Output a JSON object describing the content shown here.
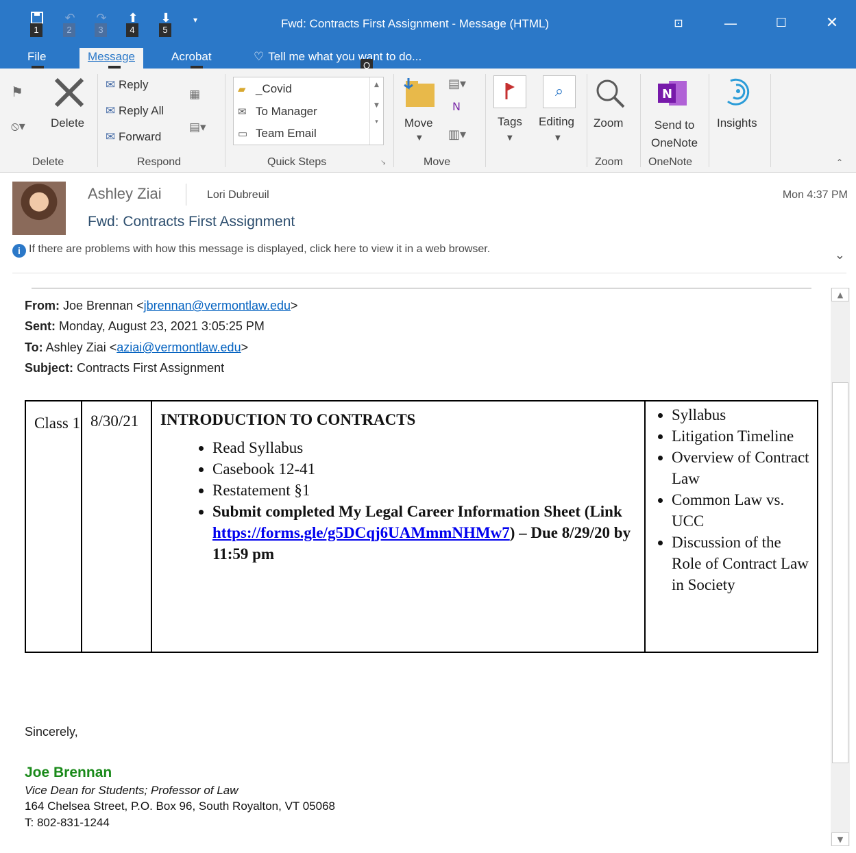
{
  "window": {
    "title": "Fwd: Contracts First Assignment - Message (HTML)",
    "qat": [
      {
        "icon": "save-icon",
        "key": "1"
      },
      {
        "icon": "undo-icon",
        "key": "2"
      },
      {
        "icon": "redo-icon",
        "key": "3"
      },
      {
        "icon": "up-arrow-icon",
        "key": "4"
      },
      {
        "icon": "down-arrow-icon",
        "key": "5"
      }
    ],
    "controls": [
      "ribbon-display-icon",
      "minimize-icon",
      "maximize-icon",
      "close-icon"
    ]
  },
  "tabs": {
    "file": "File",
    "file_key": "F",
    "message": "Message",
    "message_key": "H",
    "acrobat": "Acrobat",
    "acrobat_key": "B",
    "tell_me": "Tell me what you want to do...",
    "tell_me_key": "Q"
  },
  "ribbon": {
    "delete_group": {
      "label": "Delete",
      "delete": "Delete"
    },
    "respond_group": {
      "label": "Respond",
      "reply": "Reply",
      "reply_all": "Reply All",
      "forward": "Forward"
    },
    "quick_steps": {
      "label": "Quick Steps",
      "items": [
        "_Covid",
        "To Manager",
        "Team Email"
      ]
    },
    "move_group": {
      "label": "Move",
      "move": "Move"
    },
    "tags": "Tags",
    "editing": "Editing",
    "zoom_group": {
      "label": "Zoom",
      "zoom": "Zoom"
    },
    "onenote_group": {
      "label": "OneNote",
      "send_to": "Send to",
      "onenote": "OneNote"
    },
    "insights": "Insights"
  },
  "message": {
    "sender": "Ashley Ziai",
    "recipient": "Lori Dubreuil",
    "time": "Mon 4:37 PM",
    "subject": "Fwd: Contracts First Assignment",
    "info": "If there are problems with how this message is displayed, click here to view it in a web browser."
  },
  "forwarded": {
    "from_label": "From:",
    "from_name": "Joe Brennan <",
    "from_email": "jbrennan@vermontlaw.edu",
    "from_end": ">",
    "sent_label": "Sent:",
    "sent_value": "Monday, August 23, 2021 3:05:25 PM",
    "to_label": "To:",
    "to_name": "Ashley Ziai <",
    "to_email": "aziai@vermontlaw.edu",
    "to_end": ">",
    "subject_label": "Subject:",
    "subject_value": "Contracts First Assignment"
  },
  "schedule": {
    "class": "Class 1",
    "date": "8/30/21",
    "heading": "INTRODUCTION TO CONTRACTS",
    "items": [
      "Read Syllabus",
      "Casebook 12-41",
      "Restatement §1"
    ],
    "submit_prefix": "Submit completed My Legal Career Information Sheet (Link ",
    "submit_link": "https://forms.gle/g5DCqj6UAMmmNHMw7",
    "submit_suffix": ") – Due 8/29/20 by 11:59 pm",
    "topics": [
      "Syllabus",
      "Litigation Timeline",
      "Overview of Contract Law",
      "Common Law vs. UCC",
      "Discussion of the Role of Contract Law in Society"
    ]
  },
  "signature": {
    "closing": "Sincerely,",
    "name": "Joe Brennan",
    "title": "Vice Dean for Students; Professor of Law",
    "address": "164 Chelsea Street, P.O. Box 96, South Royalton, VT 05068",
    "phone": "T: 802-831-1244"
  }
}
